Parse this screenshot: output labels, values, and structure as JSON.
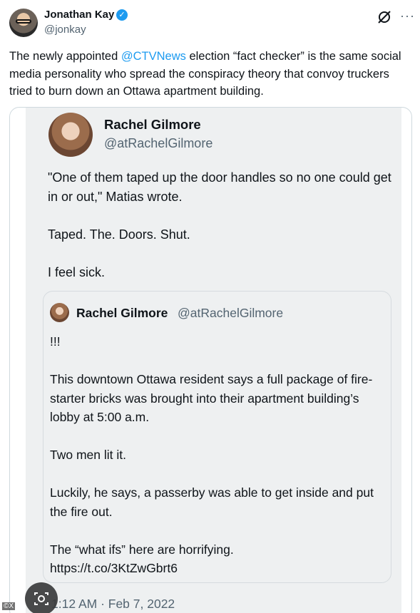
{
  "author": {
    "name": "Jonathan Kay",
    "handle": "@jonkay",
    "verified_icon": "verified-badge-icon"
  },
  "header_icons": {
    "grok": "x-slash-icon",
    "more": "more-icon",
    "more_glyph": "···"
  },
  "tweet": {
    "text_before": "The newly appointed ",
    "mention": "@CTVNews",
    "text_after": " election “fact checker” is the same social media personality who spread the conspiracy theory that convoy truckers tried to burn down an Ottawa apartment building."
  },
  "quote": {
    "name": "Rachel Gilmore",
    "handle": "@atRachelGilmore",
    "paragraphs": [
      "\"One of them taped up the door handles so no one could get in or out,\" Matias wrote.",
      "Taped. The. Doors. Shut.",
      "I feel sick."
    ],
    "nested": {
      "name": "Rachel Gilmore",
      "handle": "@atRachelGilmore",
      "paragraphs": [
        "!!!",
        "This downtown Ottawa resident says a full package of fire-starter bricks was brought into their apartment building’s lobby at 5:00 a.m.",
        "Two men lit it.",
        "Luckily, he says, a passerby was able to get inside and put the fire out."
      ],
      "last_line": "The “what ifs” here are horrifying.",
      "link": "https://t.co/3KtZwGbrt6"
    },
    "timestamp": "1:12 AM · Feb 7, 2022"
  },
  "overlay": {
    "watermark": "©X"
  },
  "colors": {
    "accent": "#1d9bf0",
    "secondary_text": "#536471",
    "quote_bg": "#eef0f1"
  }
}
